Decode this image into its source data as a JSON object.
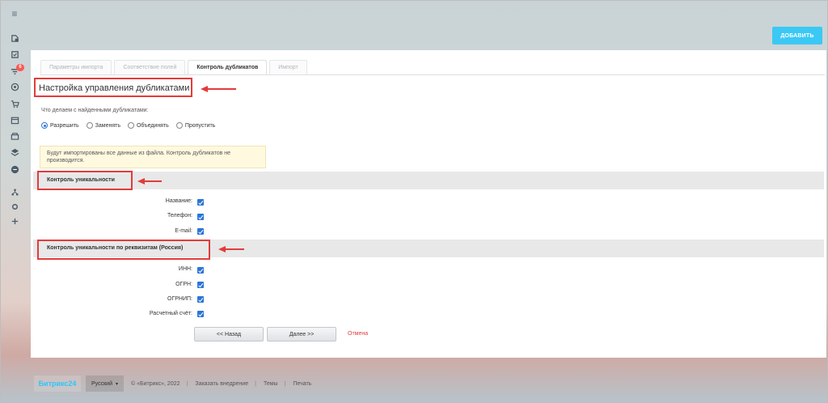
{
  "header": {
    "add_button": "ДОБАВИТЬ"
  },
  "sidebar": {
    "badge": "6"
  },
  "tabs": [
    {
      "label": "Параметры импорта",
      "active": false
    },
    {
      "label": "Соответствие полей",
      "active": false
    },
    {
      "label": "Контроль дубликатов",
      "active": true
    },
    {
      "label": "Импорт",
      "active": false
    }
  ],
  "page_title": "Настройка управления дубликатами",
  "question": "Что делаем с найденными дубликатами:",
  "radio_options": [
    {
      "label": "Разрешить",
      "checked": true
    },
    {
      "label": "Заменять",
      "checked": false
    },
    {
      "label": "Объединять",
      "checked": false
    },
    {
      "label": "Пропустить",
      "checked": false
    }
  ],
  "notice": "Будут импортированы все данные из файла. Контроль дубликатов не производится.",
  "sections": [
    {
      "title": "Контроль уникальности",
      "fields": [
        {
          "label": "Название:",
          "checked": true
        },
        {
          "label": "Телефон:",
          "checked": true
        },
        {
          "label": "E-mail:",
          "checked": true
        }
      ]
    },
    {
      "title": "Контроль уникальности по реквизитам (Россия)",
      "fields": [
        {
          "label": "ИНН:",
          "checked": true
        },
        {
          "label": "ОГРН:",
          "checked": true
        },
        {
          "label": "ОГРНИП:",
          "checked": true
        },
        {
          "label": "Расчетный счёт:",
          "checked": true
        }
      ]
    }
  ],
  "buttons": {
    "back": "<< Назад",
    "next": "Далее >>",
    "cancel": "Отмена"
  },
  "footer": {
    "logo_text": "Битрикс",
    "logo_num": "24",
    "language": "Русский",
    "copyright": "© «Битрикс», 2022",
    "links": [
      "Заказать внедрение",
      "Темы",
      "Печать"
    ]
  },
  "colors": {
    "accent": "#3bc8f5",
    "checkbox": "#2b75d6",
    "annotation": "#e33b3b",
    "cancel": "#e33b3b"
  }
}
